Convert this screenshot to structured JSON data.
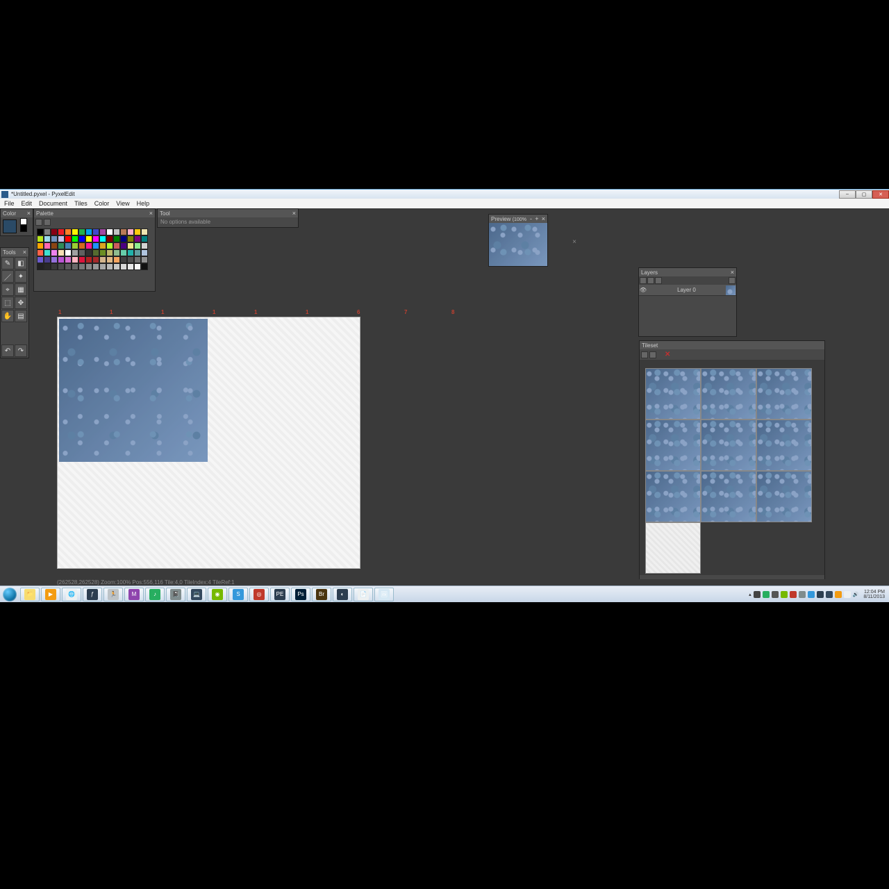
{
  "titlebar": {
    "text": "*Untitled.pyxel - PyxelEdit"
  },
  "menu": {
    "file": "File",
    "edit": "Edit",
    "document": "Document",
    "tiles": "Tiles",
    "color": "Color",
    "view": "View",
    "help": "Help"
  },
  "panels": {
    "color": {
      "title": "Color",
      "swatch_main": "#2a4a66"
    },
    "palette": {
      "title": "Palette"
    },
    "tool": {
      "title": "Tool",
      "body": "No options available"
    },
    "preview": {
      "title": "Preview",
      "zoom": "(100%"
    },
    "layers": {
      "title": "Layers",
      "layer0": "Layer 0"
    },
    "tileset": {
      "title": "Tileset"
    },
    "tools": {
      "title": "Tools"
    }
  },
  "ruler": {
    "n1": "1",
    "n2": "1",
    "n3": "1",
    "n4": "1",
    "n5": "1",
    "n6": "1",
    "n7": "6",
    "n8": "7",
    "n9": "8"
  },
  "statusbar": {
    "text": "(262528,262528)   Zoom:100%   Pos:556,116   Tile:4,0   TileIndex:4   TileRef:1"
  },
  "systray": {
    "time": "12:04 PM",
    "date": "8/11/2013"
  },
  "palette_colors": [
    "#000000",
    "#7f7f7f",
    "#880015",
    "#ed1c24",
    "#ff7f27",
    "#fff200",
    "#22b14c",
    "#00a2e8",
    "#3f48cc",
    "#a349a4",
    "#ffffff",
    "#c3c3c3",
    "#b97a57",
    "#ffaec9",
    "#ffc90e",
    "#efe4b0",
    "#b5e61d",
    "#99d9ea",
    "#7092be",
    "#c8bfe7",
    "#ff0000",
    "#00ff00",
    "#0000ff",
    "#ffff00",
    "#ff00ff",
    "#00ffff",
    "#800000",
    "#008000",
    "#000080",
    "#808000",
    "#800080",
    "#008080",
    "#ffa500",
    "#ff69b4",
    "#8b4513",
    "#2e8b57",
    "#4682b4",
    "#9acd32",
    "#d2691e",
    "#ff1493",
    "#1e90ff",
    "#daa520",
    "#adff2f",
    "#cd5c5c",
    "#4b0082",
    "#f0e68c",
    "#90ee90",
    "#d3d3d3",
    "#ff6347",
    "#40e0d0",
    "#ee82ee",
    "#f5deb3",
    "#ffffff",
    "#a0a0a0",
    "#606060",
    "#303030",
    "#556b2f",
    "#6b8e23",
    "#bdb76b",
    "#8fbc8f",
    "#66cdaa",
    "#20b2aa",
    "#5f9ea0",
    "#b0c4de",
    "#6a5acd",
    "#483d8b",
    "#9370db",
    "#ba55d3",
    "#da70d6",
    "#ffb6c1",
    "#dc143c",
    "#b22222",
    "#a52a2a",
    "#d2b48c",
    "#deb887",
    "#f4a460",
    "#404040",
    "#505050",
    "#707070",
    "#909090",
    "#202020",
    "#282828",
    "#383838",
    "#484848",
    "#585858",
    "#686868",
    "#787878",
    "#888888",
    "#989898",
    "#a8a8a8",
    "#b8b8b8",
    "#c8c8c8",
    "#d8d8d8",
    "#e8e8e8",
    "#f8f8f8",
    "#111111"
  ],
  "taskbar_icons": [
    {
      "bg": "#f7dc6f",
      "glyph": "📁"
    },
    {
      "bg": "#f39c12",
      "glyph": "▶"
    },
    {
      "bg": "#ecf0f1",
      "glyph": "🌐"
    },
    {
      "bg": "#2c3e50",
      "glyph": "ƒ"
    },
    {
      "bg": "#bdc3c7",
      "glyph": "🏃"
    },
    {
      "bg": "#8e44ad",
      "glyph": "M"
    },
    {
      "bg": "#27ae60",
      "glyph": "♪"
    },
    {
      "bg": "#7f8c8d",
      "glyph": "📓"
    },
    {
      "bg": "#34495e",
      "glyph": "💻"
    },
    {
      "bg": "#76b900",
      "glyph": "◉"
    },
    {
      "bg": "#3498db",
      "glyph": "S"
    },
    {
      "bg": "#c0392b",
      "glyph": "◎"
    },
    {
      "bg": "#2c3e50",
      "glyph": "PE"
    },
    {
      "bg": "#001e36",
      "glyph": "Ps"
    },
    {
      "bg": "#4a3510",
      "glyph": "Br"
    },
    {
      "bg": "#2c3e50",
      "glyph": "◐"
    },
    {
      "bg": "#ecf0f1",
      "glyph": "📄"
    },
    {
      "bg": "#d5e8f4",
      "glyph": "🖼"
    }
  ]
}
